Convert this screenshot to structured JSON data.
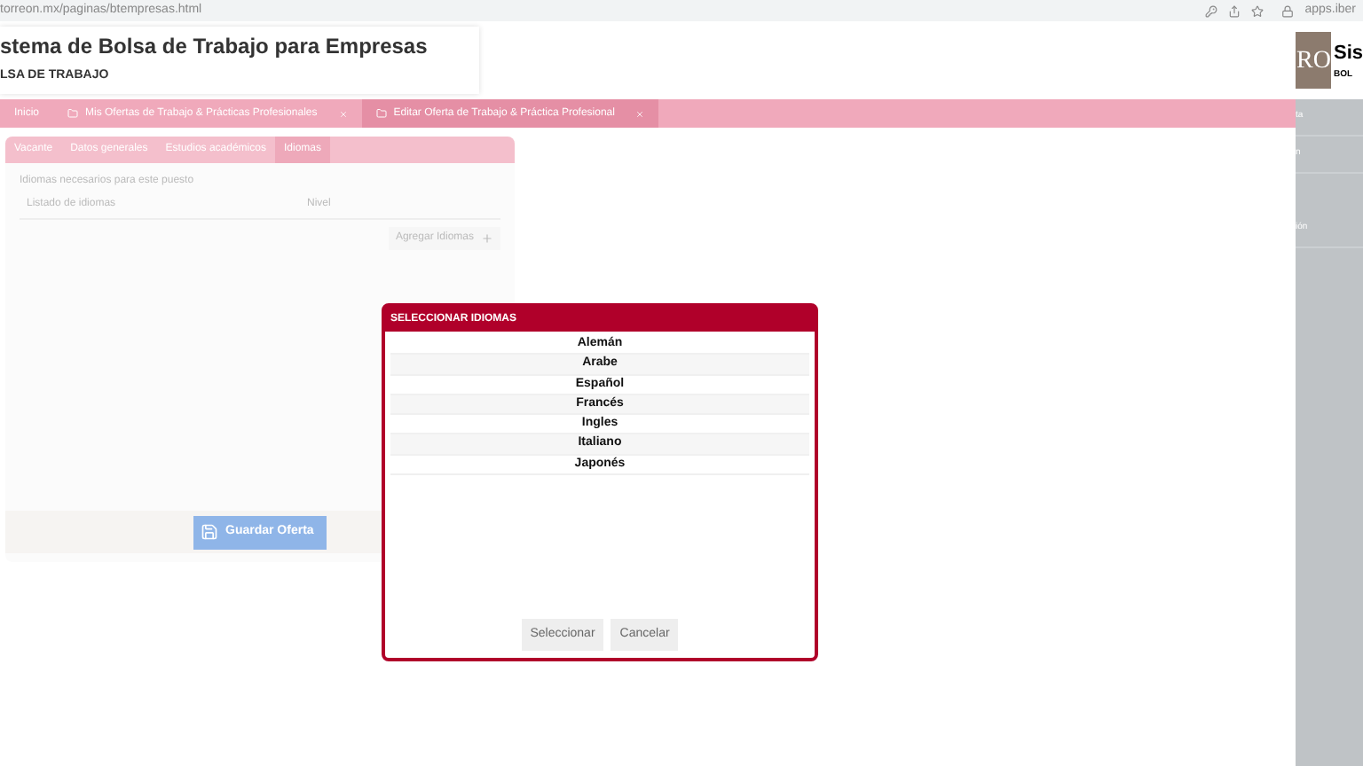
{
  "browser": {
    "url": "torreon.mx/paginas/btempresas.html",
    "url_right": "apps.iber"
  },
  "header": {
    "title": "stema de Bolsa de Trabajo para Empresas",
    "subtitle": "LSA DE TRABAJO",
    "logo": "RO",
    "title_right": "Sis",
    "subtitle_right": "BOL"
  },
  "nav_tabs": [
    {
      "label": "Inicio",
      "closable": false,
      "selected": false
    },
    {
      "label": "Mis Ofertas de Trabajo & Prácticas Profesionales",
      "closable": true,
      "selected": false
    },
    {
      "label": "Editar Oferta de Trabajo & Práctica Profesional",
      "closable": true,
      "selected": true
    }
  ],
  "sidebar_right": {
    "items": [
      "ta",
      "n",
      "ión"
    ]
  },
  "form": {
    "tabs": [
      {
        "label": "Vacante",
        "selected": false
      },
      {
        "label": "Datos generales",
        "selected": false
      },
      {
        "label": "Estudios académicos",
        "selected": false
      },
      {
        "label": "Idiomas",
        "selected": true
      }
    ],
    "section_label": "Idiomas necesarios para este puesto",
    "columns": [
      "Listado de idiomas",
      "Nivel"
    ],
    "add_button": "Agregar Idiomas",
    "save_button": "Guardar Oferta"
  },
  "dialog": {
    "title": "SELECCIONAR IDIOMAS",
    "items": [
      "Alemán",
      "Arabe",
      "Español",
      "Francés",
      "Ingles",
      "Italiano",
      "Japonés"
    ],
    "buttons": [
      "Seleccionar",
      "Cancelar"
    ]
  }
}
